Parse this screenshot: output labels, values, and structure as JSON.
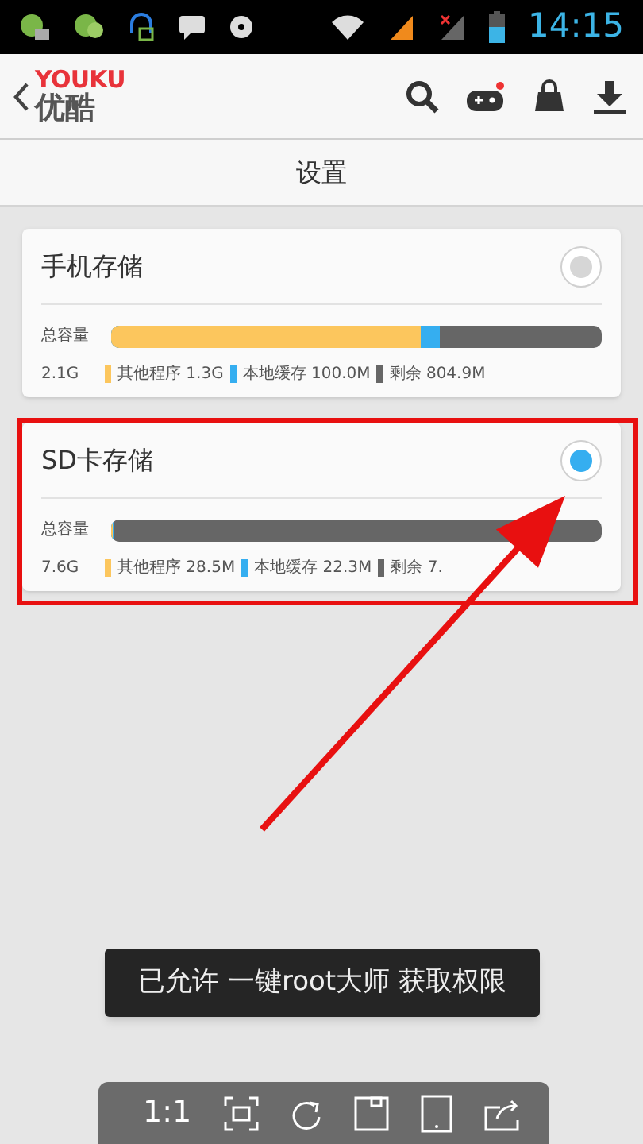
{
  "status_bar": {
    "time": "14:15"
  },
  "header": {
    "logo_top": "YOUKU",
    "logo_bottom": "优酷"
  },
  "page_title": "设置",
  "storage": [
    {
      "name": "手机存储",
      "selected": false,
      "total_label": "总容量",
      "total": "2.1G",
      "bar": {
        "used": {
          "level": 0.67
        },
        "other": {
          "level": 0.63
        }
      },
      "segments": [
        {
          "kind": "other",
          "label": "其他程序 1.3G"
        },
        {
          "kind": "cache",
          "label": "本地缓存 100.0M"
        },
        {
          "kind": "free",
          "label": "剩余 804.9M"
        }
      ]
    },
    {
      "name": "SD卡存储",
      "selected": true,
      "total_label": "总容量",
      "total": "7.6G",
      "bar": {
        "used": {
          "level": 0.007
        },
        "other": {
          "level": 0.004
        }
      },
      "segments": [
        {
          "kind": "other",
          "label": "其他程序 28.5M"
        },
        {
          "kind": "cache",
          "label": "本地缓存 22.3M"
        },
        {
          "kind": "free",
          "label": "剩余 7."
        }
      ]
    }
  ],
  "toast": "已允许 一键root大师 获取权限",
  "viewer_toolbar": {
    "zoom_label": "1:1"
  }
}
